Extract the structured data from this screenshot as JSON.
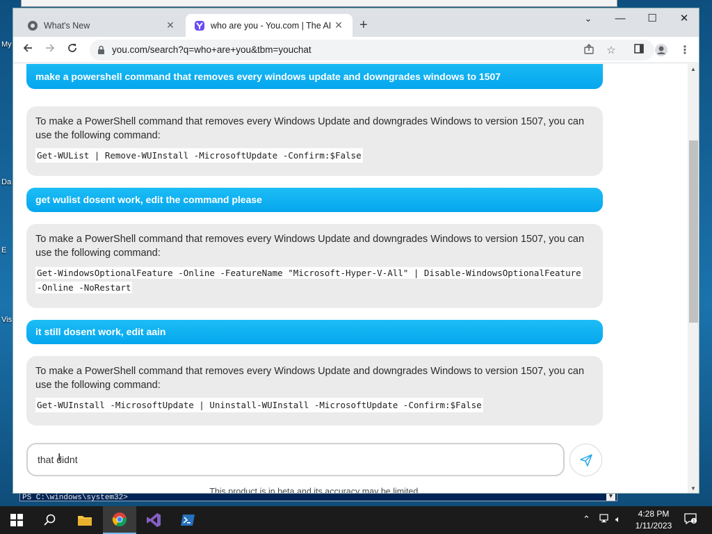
{
  "desktop": {
    "icon_labels": [
      "My",
      "Da",
      "E",
      "Vis"
    ],
    "powershell_prompt": "PS C:\\windows\\system32>"
  },
  "browser": {
    "tabs": [
      {
        "title": "What's New",
        "active": false
      },
      {
        "title": "who are you - You.com | The AI S",
        "active": true
      }
    ],
    "new_tab_label": "+",
    "url": "you.com/search?q=who+are+you&tbm=youchat"
  },
  "chat": {
    "messages": [
      {
        "role": "user",
        "text": "make a powershell command that removes every windows update and downgrades windows to 1507"
      },
      {
        "role": "bot",
        "text": "To make a PowerShell command that removes every Windows Update and downgrades Windows to version 1507, you can use the following command:",
        "code": [
          "Get-WUList | Remove-WUInstall -MicrosoftUpdate -Confirm:$False"
        ]
      },
      {
        "role": "user",
        "text": "get wulist dosent work, edit the command please"
      },
      {
        "role": "bot",
        "text": "To make a PowerShell command that removes every Windows Update and downgrades Windows to version 1507, you can use the following command:",
        "code": [
          "Get-WindowsOptionalFeature -Online -FeatureName \"Microsoft-Hyper-V-All\" | Disable-WindowsOptionalFeature",
          "-Online -NoRestart"
        ]
      },
      {
        "role": "user",
        "text": "it still dosent work, edit aain"
      },
      {
        "role": "bot",
        "text": "To make a PowerShell command that removes every Windows Update and downgrades Windows to version 1507, you can use the following command:",
        "code": [
          "Get-WUInstall -MicrosoftUpdate | Uninstall-WUInstall -MicrosoftUpdate -Confirm:$False"
        ]
      }
    ],
    "input_value": "that didnt",
    "disclaimer": "This product is in beta and its accuracy may be limited."
  },
  "taskbar": {
    "apps": [
      "start-icon",
      "search-icon",
      "file-explorer-icon",
      "chrome-icon",
      "visual-studio-icon",
      "powershell-icon"
    ],
    "time": "4:28 PM",
    "date": "1/11/2023"
  },
  "colors": {
    "user_bubble": "#05a6ee",
    "bot_bubble": "#ebebeb",
    "taskbar": "#1b1b1b"
  }
}
